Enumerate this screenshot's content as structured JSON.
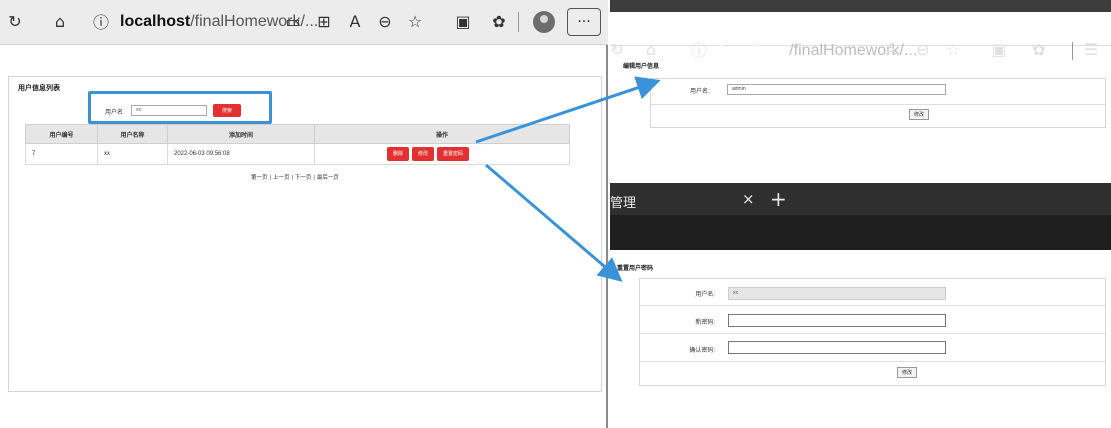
{
  "left_window": {
    "browser": {
      "url_host": "localhost",
      "url_path": "/finalHomework/...",
      "icons": [
        "reload-icon",
        "home-icon",
        "info-icon",
        "reader-icon",
        "apps-icon",
        "read-aloud-icon",
        "zoom-out-icon",
        "favorite-icon",
        "collections-icon",
        "extensions-icon",
        "profile-icon",
        "more-icon"
      ],
      "more_label": "···"
    },
    "page_title": "用户信息列表",
    "search": {
      "label": "用户名",
      "value": "xx",
      "button_label": "搜索"
    },
    "table": {
      "headers": [
        "用户编号",
        "用户名称",
        "添加时间",
        "操作"
      ],
      "rows": [
        {
          "id": "7",
          "name": "xx",
          "time": "2022-06-03 09:56:08",
          "actions": [
            "删除",
            "修改",
            "重置密码"
          ]
        }
      ]
    },
    "pager": [
      "第一页",
      "|",
      "上一页",
      "|",
      "下一页",
      "|",
      "最后一页"
    ]
  },
  "edit_window": {
    "title": "编辑用户信息",
    "username_label": "用户名:",
    "username_value": "admin",
    "submit_label": "修改"
  },
  "reset_window": {
    "tab_title": "管理",
    "tab_close": "×",
    "tab_new": "+",
    "url_host": "localhost",
    "url_path": "/finalHomework/...",
    "title": "重置用户密码",
    "username_label": "用户名:",
    "username_value": "xx",
    "new_password_label": "新密码:",
    "confirm_password_label": "确认密码:",
    "submit_label": "修改"
  },
  "colors": {
    "accent_blue": "#3a93d8",
    "danger_red": "#e43030"
  }
}
